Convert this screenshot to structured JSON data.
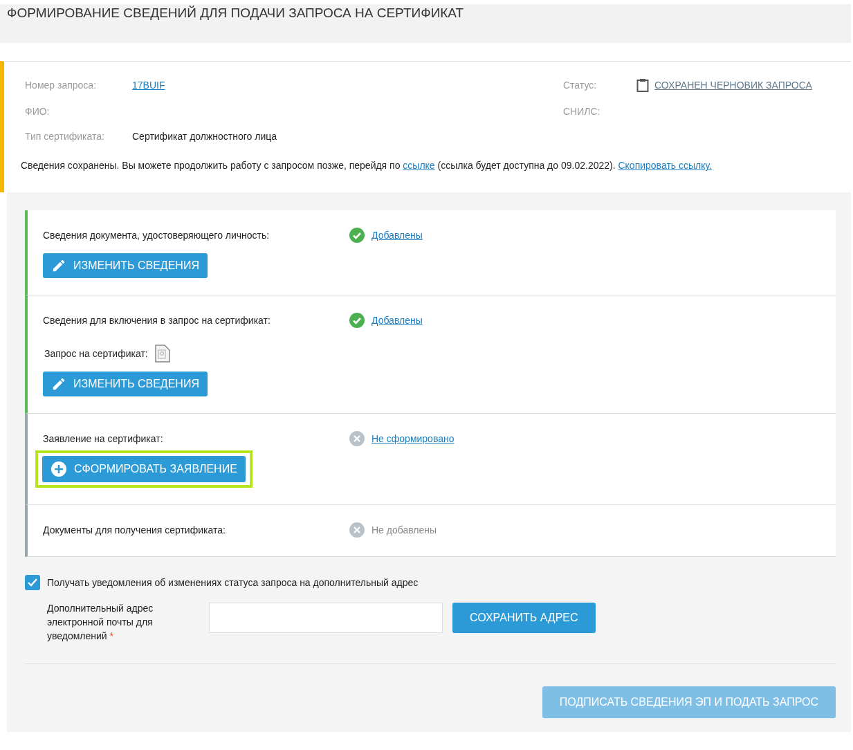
{
  "title": "ФОРМИРОВАНИЕ СВЕДЕНИЙ ДЛЯ ПОДАЧИ ЗАПРОСА НА СЕРТИФИКАТ",
  "info": {
    "request_label": "Номер запроса:",
    "request_number": "17BUIF",
    "status_label": "Статус:",
    "status_value": "СОХРАНЕН ЧЕРНОВИК ЗАПРОСА",
    "fio_label": "ФИО:",
    "snils_label": "СНИЛС:",
    "type_label": "Тип сертификата:",
    "type_value": "Сертификат должностного лица",
    "notice": "Сведения сохранены. Вы можете продолжить работу с запросом позже, перейдя по",
    "notice_link": "ссылке",
    "notice_tail": "(ссылка будет доступна до 09.02.2022).",
    "copy_link": "Скопировать ссылку."
  },
  "sections": [
    {
      "label": "Сведения документа, удостоверяющего личность:",
      "added": true,
      "status_text": "Добавлены",
      "status_link": true,
      "button": {
        "kind": "edit",
        "label": "ИЗМЕНИТЬ СВЕДЕНИЯ",
        "highlighted": false
      }
    },
    {
      "label": "Сведения для включения в запрос на сертификат:",
      "added": true,
      "status_text": "Добавлены",
      "status_link": true,
      "file_label": "Запрос на сертификат:",
      "button": {
        "kind": "edit",
        "label": "ИЗМЕНИТЬ СВЕДЕНИЯ",
        "highlighted": false
      }
    },
    {
      "label": "Заявление на сертификат:",
      "added": false,
      "status_text": "Не сформировано",
      "status_link": true,
      "button": {
        "kind": "add",
        "label": "СФОРМИРОВАТЬ ЗАЯВЛЕНИЕ",
        "highlighted": true
      }
    },
    {
      "label": "Документы для получения сертификата:",
      "added": false,
      "status_text": "Не добавлены",
      "status_link": false
    }
  ],
  "notify": {
    "label": "Получать уведомления об изменениях статуса запроса на дополнительный адрес",
    "checked": true,
    "field_label": "Дополнительный адрес электронной почты для уведомлений",
    "required_mark": "*",
    "save_button": "СОХРАНИТЬ АДРЕС"
  },
  "sign_button": {
    "label": "ПОДПИСАТЬ СВЕДЕНИЯ ЭП И ПОДАТЬ ЗАПРОС",
    "disabled": true
  }
}
